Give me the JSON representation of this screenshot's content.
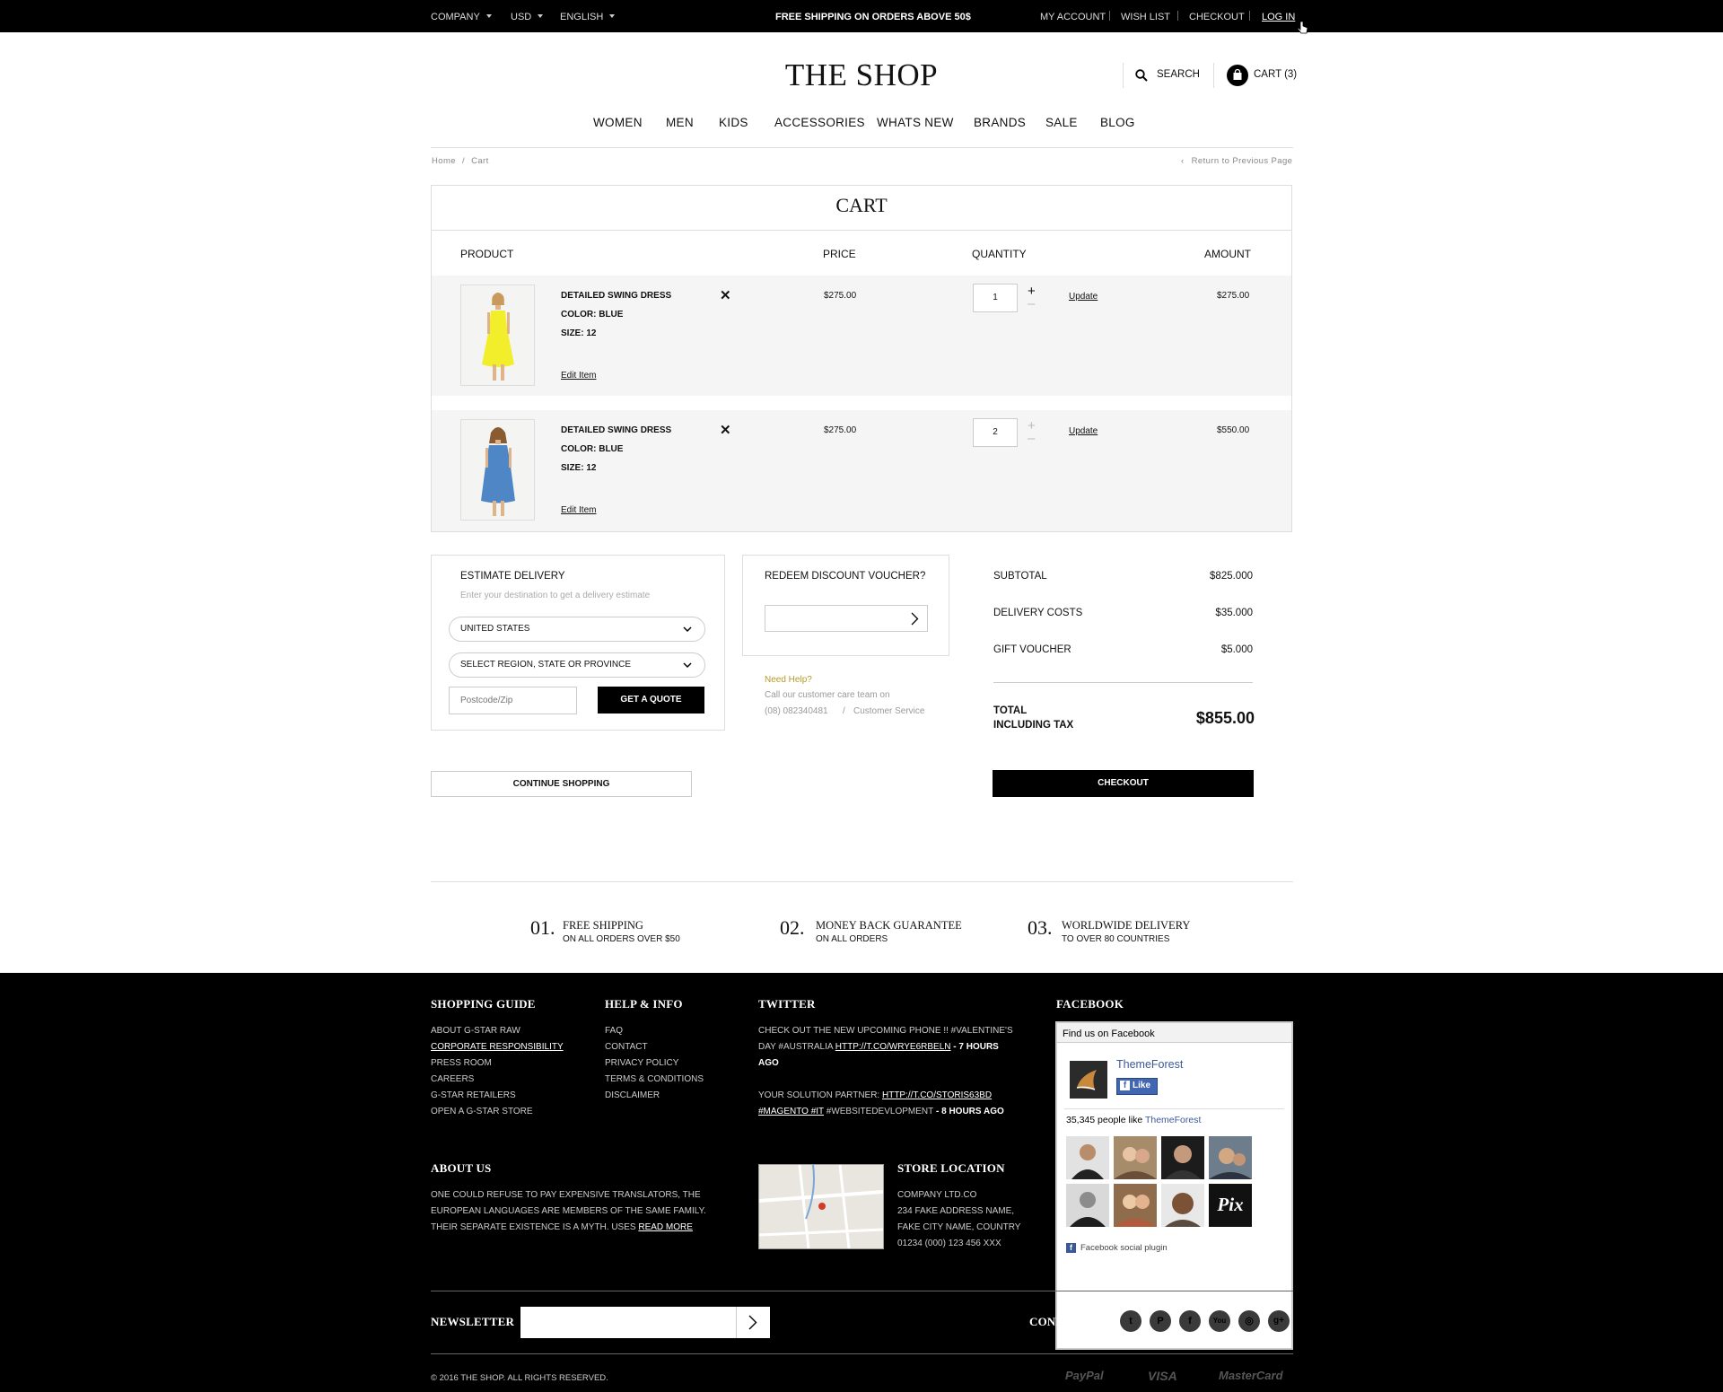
{
  "topbar": {
    "company": "COMPANY",
    "currency": "USD",
    "language": "ENGLISH",
    "promo": "FREE SHIPPING ON ORDERS ABOVE 50$",
    "my_account": "MY ACCOUNT",
    "wish_list": "WISH LIST",
    "checkout": "CHECKOUT",
    "login": "LOG IN"
  },
  "header": {
    "logo": "THE SHOP",
    "search": "SEARCH",
    "cart": "CART (3)",
    "nav": [
      "WOMEN",
      "MEN",
      "KIDS",
      "ACCESSORIES",
      "WHATS NEW",
      "BRANDS",
      "SALE",
      "BLOG"
    ]
  },
  "breadcrumb": {
    "home": "Home",
    "sep": "/",
    "current": "Cart",
    "back": "Return to Previous Page"
  },
  "cart": {
    "title": "CART",
    "columns": {
      "product": "PRODUCT",
      "price": "PRICE",
      "quantity": "QUANTITY",
      "amount": "AMOUNT"
    },
    "items": [
      {
        "name": "DETAILED SWING DRESS",
        "color": "COLOR: BLUE",
        "size": "SIZE: 12",
        "edit": "Edit Item",
        "price": "$275.00",
        "qty": "1",
        "update": "Update",
        "amount": "$275.00",
        "swatch": "#f2ee2c"
      },
      {
        "name": "DETAILED SWING DRESS",
        "color": "COLOR: BLUE",
        "size": "SIZE: 12",
        "edit": "Edit Item",
        "price": "$275.00",
        "qty": "2",
        "update": "Update",
        "amount": "$550.00",
        "swatch": "#4f86c6"
      }
    ]
  },
  "delivery": {
    "title": "ESTIMATE DELIVERY",
    "subtitle": "Enter your destination to get a delivery estimate",
    "country": "UNITED STATES",
    "region": "SELECT REGION, STATE OR PROVINCE",
    "postcode_placeholder": "Postcode/Zip",
    "quote": "GET A QUOTE"
  },
  "voucher": {
    "title": "REDEEM DISCOUNT VOUCHER?",
    "help_title": "Need Help?",
    "help_text": "Call our customer care team on",
    "phone": "(08) 082340481",
    "slash": "/",
    "service": "Customer Service"
  },
  "summary": {
    "subtotal_label": "SUBTOTAL",
    "subtotal": "$825.000",
    "delivery_label": "DELIVERY COSTS",
    "delivery": "$35.000",
    "voucher_label": "GIFT VOUCHER",
    "voucher": "$5.000",
    "total_label_1": "TOTAL",
    "total_label_2": "INCLUDING TAX",
    "total": "$855.00"
  },
  "actions": {
    "continue": "CONTINUE SHOPPING",
    "checkout": "CHECKOUT"
  },
  "features": [
    {
      "num": "01.",
      "title": "FREE SHIPPING",
      "sub": "ON ALL ORDERS OVER $50"
    },
    {
      "num": "02.",
      "title": "MONEY BACK GUARANTEE",
      "sub": "ON ALL ORDERS"
    },
    {
      "num": "03.",
      "title": "WORLDWIDE DELIVERY",
      "sub": "TO OVER 80 COUNTRIES"
    }
  ],
  "footer": {
    "guide_title": "SHOPPING GUIDE",
    "guide": [
      "ABOUT G-STAR RAW",
      "CORPORATE RESPONSIBILITY",
      "PRESS ROOM",
      "CAREERS",
      "G-STAR RETAILERS",
      "OPEN A G-STAR STORE"
    ],
    "help_title": "HELP & INFO",
    "help": [
      "FAQ",
      "CONTACT",
      "PRIVACY POLICY",
      "TERMS & CONDITIONS",
      "DISCLAIMER"
    ],
    "twitter_title": "TWITTER",
    "tweet1_a": "CHECK OUT THE NEW UPCOMING PHONE !! #VALENTINE'S DAY #AUSTRALIA ",
    "tweet1_link": "HTTP://T.CO/WRYE6RBELN",
    "tweet1_time": " - 7 HOURS AGO",
    "tweet2_a": "YOUR SOLUTION PARTNER: ",
    "tweet2_link": "HTTP://T.CO/STORIS63BD",
    "tweet2_tags": "#MAGENTO #IT",
    "tweet2_b": " #WEBSITEDEVLOPMENT",
    "tweet2_time": " - 8 HOURS AGO",
    "facebook_title": "FACEBOOK",
    "fb_find": "Find us on Facebook",
    "fb_page": "ThemeForest",
    "fb_like": "Like",
    "fb_people": "35,345 people like ",
    "fb_people_page": "ThemeForest",
    "fb_plugin": "Facebook social plugin",
    "about_title": "ABOUT US",
    "about_text": "ONE COULD REFUSE TO PAY EXPENSIVE TRANSLATORS, THE EUROPEAN LANGUAGES ARE MEMBERS OF THE SAME FAMILY. THEIR SEPARATE EXISTENCE IS A MYTH. USES ",
    "read_more": "READ MORE",
    "store_title": "STORE LOCATION",
    "store": [
      "COMPANY LTD.CO",
      "234 FAKE ADDRESS NAME,",
      "FAKE CITY NAME, COUNTRY",
      "01234 (000) 123 456 XXX"
    ],
    "newsletter": "NEWSLETTER",
    "connect": "CONNECT US",
    "copyright": "© 2016 THE SHOP. ALL RIGHTS RESERVED.",
    "payments": [
      "PayPal",
      "VISA",
      "MasterCard"
    ]
  }
}
